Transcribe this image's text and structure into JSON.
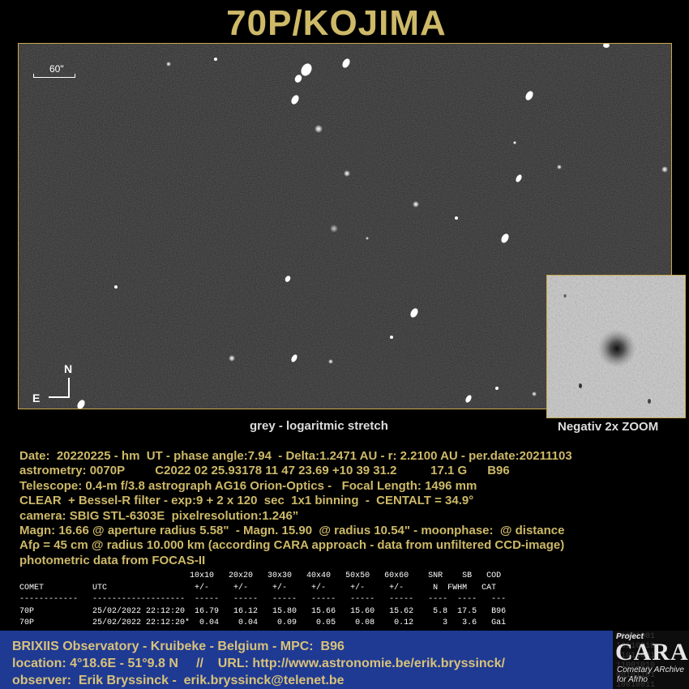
{
  "title": "70P/KOJIMA",
  "image": {
    "scale_label": "60\"",
    "compass_n": "N",
    "compass_e": "E"
  },
  "captions": {
    "grey": "grey -  logaritmic stretch",
    "zoom": "Negativ 2x ZOOM"
  },
  "info_lines": [
    "Date:  20220225 - hm  UT - phase angle:7.94  - Delta:1.2471 AU - r: 2.2100 AU - per.date:20211103",
    "astrometry: 0070P         C2022 02 25.93178 11 47 23.69 +10 39 31.2          17.1 G      B96",
    "Telescope: 0.4-m f/3.8 astrograph AG16 Orion-Optics -   Focal Length: 1496 mm",
    "CLEAR  + Bessel-R filter - exp:9 + 2 x 120  sec  1x1 binning  -  CENTALT = 34.9°",
    "camera: SBIG STL-6303E  pixelresolution:1.246”",
    "Magn: 16.66 @ aperture radius 5.58\"  - Magn. 15.90  @ radius 10.54\" - moonphase:  @ distance",
    "Afρ = 45 cm @ radius 10.000 km (according CARA approach - data from unfiltered CCD-image)",
    "photometric data from FOCAS-II"
  ],
  "table_lines": [
    "                                   10x10   20x20   30x30   40x40   50x50   60x60    SNR    SB   COD",
    "COMET          UTC                  +/-     +/-     +/-     +/-     +/-     +/-      N  FWHM   CAT",
    "------------   -------------------  -----   -----   -----   -----   -----   -----   ----  ----   ---",
    "70P            25/02/2022 22:12:20  16.79   16.12   15.80   15.66   15.60   15.62    5.8  17.5   B96",
    "70P            25/02/2022 22:12:20*  0.04    0.04    0.09    0.05    0.08    0.12      3   3.6   Gai"
  ],
  "footer": {
    "line1": "BRIXIIS Observatory - Kruibeke - Belgium - MPC:  B96",
    "line2": "location: 4°18.6E - 51°9.8 N     //    URL: http://www.astronomie.be/erik.bryssinck/",
    "line3": "observer:  Erik Bryssinck -  erik.bryssinck@telenet.be"
  },
  "logo": {
    "project": "Project",
    "name": "CARA",
    "sub1": "Cometary ARchive",
    "sub2": "for Afrho"
  },
  "colors": {
    "title": "#cdb968",
    "frame_border": "#c9a94f",
    "footer_bg": "#1f3a93"
  }
}
